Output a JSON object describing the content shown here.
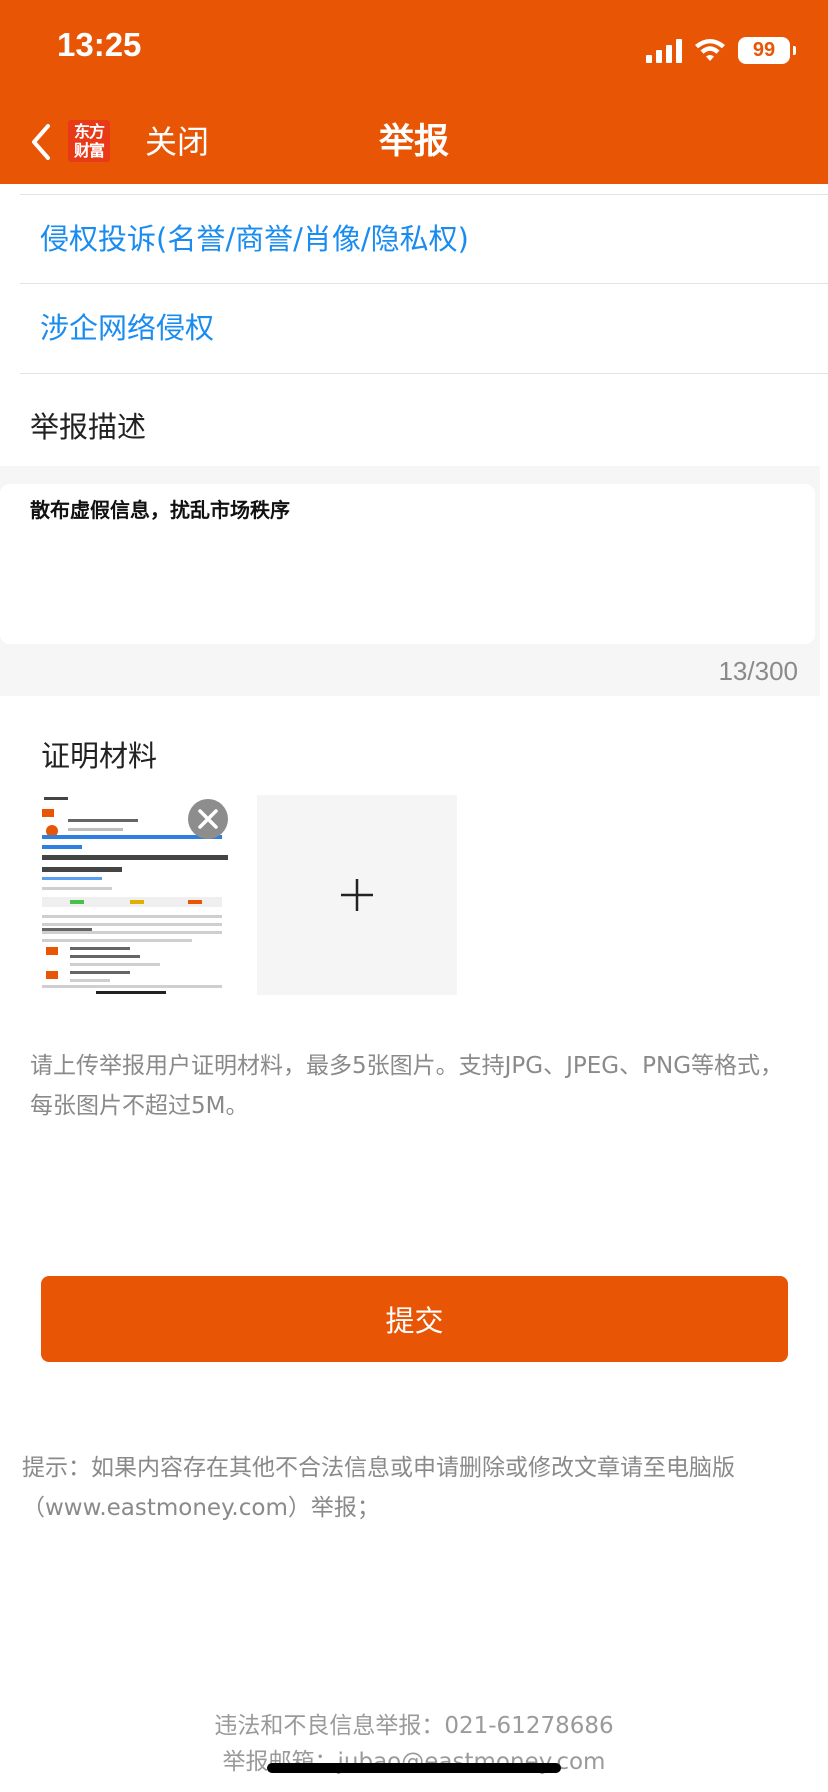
{
  "status_bar": {
    "time": "13:25",
    "battery": "99",
    "icons": [
      "signal-icon",
      "wifi-icon",
      "battery-icon"
    ]
  },
  "nav": {
    "logo_text": "东方财富",
    "close_label": "关闭",
    "title": "举报",
    "back_icon": "chevron-left-icon"
  },
  "categories": [
    {
      "label": "侵权投诉(名誉/商誉/肖像/隐私权)"
    },
    {
      "label": "涉企网络侵权"
    }
  ],
  "description": {
    "title": "举报描述",
    "value": "散布虚假信息，扰乱市场秩序",
    "count": "13/300"
  },
  "evidence": {
    "title": "证明材料",
    "remove_icon": "close-icon",
    "add_icon": "plus-icon",
    "hint": "请上传举报用户证明材料，最多5张图片。支持JPG、JPEG、PNG等格式，每张图片不超过5M。"
  },
  "submit_label": "提交",
  "tip": "提示：如果内容存在其他不合法信息或申请删除或修改文章请至电脑版（www.eastmoney.com）举报；",
  "footer": {
    "hotline": "违法和不良信息举报：021-61278686",
    "email": "举报邮箱：jubao@eastmoney.com"
  },
  "colors": {
    "brand": "#e85505",
    "link": "#1a8cf0",
    "muted": "#8a8a8a"
  }
}
